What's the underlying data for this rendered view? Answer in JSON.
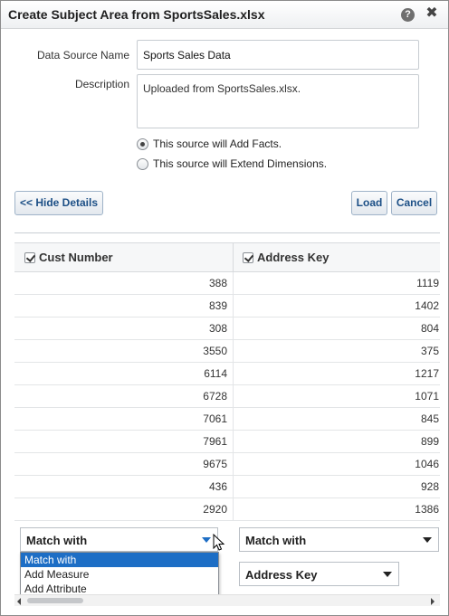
{
  "dialog": {
    "title": "Create Subject Area from SportsSales.xlsx",
    "help_icon": "?",
    "close_icon": "✖"
  },
  "form": {
    "data_source_name_label": "Data Source Name",
    "data_source_name_value": "Sports Sales Data",
    "description_label": "Description",
    "description_value": "Uploaded from SportsSales.xlsx.",
    "radio_options": [
      {
        "label": "This source will Add Facts.",
        "checked": true
      },
      {
        "label": "This source will Extend Dimensions.",
        "checked": false
      }
    ]
  },
  "buttons": {
    "hide_details": "<< Hide Details",
    "load": "Load",
    "cancel": "Cancel"
  },
  "grid": {
    "columns": [
      {
        "header": "Cust Number",
        "checked": true
      },
      {
        "header": "Address Key",
        "checked": true
      }
    ],
    "rows": [
      [
        "388",
        "1119"
      ],
      [
        "839",
        "1402"
      ],
      [
        "308",
        "804"
      ],
      [
        "3550",
        "375"
      ],
      [
        "6114",
        "1217"
      ],
      [
        "6728",
        "1071"
      ],
      [
        "7061",
        "845"
      ],
      [
        "7961",
        "899"
      ],
      [
        "9675",
        "1046"
      ],
      [
        "436",
        "928"
      ],
      [
        "2920",
        "1386"
      ]
    ],
    "column_selects": [
      {
        "value": "Match with"
      },
      {
        "value": "Match with"
      }
    ],
    "second_select": {
      "value": "Address Key"
    },
    "dropdown_options": [
      "Match with",
      "Add Measure",
      "Add Attribute"
    ],
    "dropdown_selected_index": 0
  },
  "icons": {
    "help": "help-icon",
    "close": "close-icon",
    "cursor": "mouse-pointer-icon",
    "scroll_left": "chevron-left-icon",
    "scroll_right": "chevron-right-icon"
  },
  "colors": {
    "accent": "#1d6ec5",
    "button_text": "#1c4f86"
  }
}
